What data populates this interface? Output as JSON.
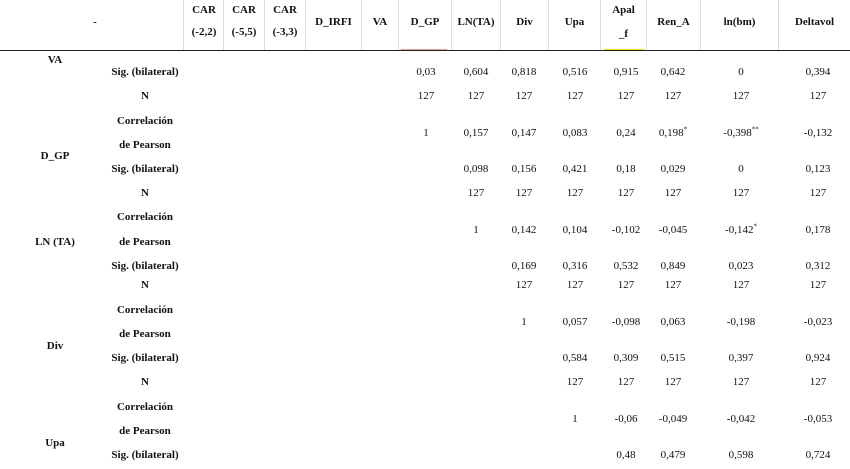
{
  "colors": {
    "d_gp_marker": "#e8a0a0",
    "apal_marker": "#f2e000"
  },
  "header": {
    "corner": "-",
    "car1_a": "CAR",
    "car1_b": "(-2,2)",
    "car2_a": "CAR",
    "car2_b": "(-5,5)",
    "car3_a": "CAR",
    "car3_b": "(-3,3)",
    "d_irfi": "D_IRFI",
    "va": "VA",
    "d_gp": "D_GP",
    "ln_ta": "LN(TA)",
    "div": "Div",
    "upa": "Upa",
    "apal_a": "Apal",
    "apal_b": "_f",
    "ren_a": "Ren_A",
    "lnbm": "ln(bm)",
    "deltavol": "Deltavol"
  },
  "sections": {
    "va": "VA",
    "d_gp": "D_GP",
    "ln_ta": "LN (TA)",
    "div": "Div",
    "upa": "Upa"
  },
  "stats": {
    "sig": "Sig. (bilateral)",
    "n": "N",
    "corr_a": "Correlación",
    "corr_b": "de Pearson"
  },
  "rows": {
    "va_sig": [
      "0,03",
      "0,604",
      "0,818",
      "0,516",
      "0,915",
      "0,642",
      "0",
      "0,394"
    ],
    "va_n": [
      "127",
      "127",
      "127",
      "127",
      "127",
      "127",
      "127",
      "127"
    ],
    "dgp_corr": [
      "1",
      "0,157",
      "0,147",
      "0,083",
      "0,24",
      "0,198",
      "-0,398",
      "-0,132"
    ],
    "dgp_sig": [
      "0,098",
      "0,156",
      "0,421",
      "0,18",
      "0,029",
      "0",
      "0,123"
    ],
    "dgp_n": [
      "127",
      "127",
      "127",
      "127",
      "127",
      "127",
      "127"
    ],
    "lnta_corr": [
      "1",
      "0,142",
      "0,104",
      "-0,102",
      "-0,045",
      "-0,142",
      "0,178"
    ],
    "lnta_sig": [
      "0,169",
      "0,316",
      "0,532",
      "0,849",
      "0,023",
      "0,312"
    ],
    "lnta_n": [
      "127",
      "127",
      "127",
      "127",
      "127",
      "127"
    ],
    "div_corr": [
      "1",
      "0,057",
      "-0,098",
      "0,063",
      "-0,198",
      "-0,023"
    ],
    "div_sig": [
      "0,584",
      "0,309",
      "0,515",
      "0,397",
      "0,924"
    ],
    "div_n": [
      "127",
      "127",
      "127",
      "127",
      "127"
    ],
    "upa_corr": [
      "1",
      "-0,06",
      "-0,049",
      "-0,042",
      "-0,053"
    ],
    "upa_sig": [
      "0,48",
      "0,479",
      "0,598",
      "0,724"
    ]
  },
  "footnote_marks": {
    "single": "*",
    "double": "**"
  }
}
